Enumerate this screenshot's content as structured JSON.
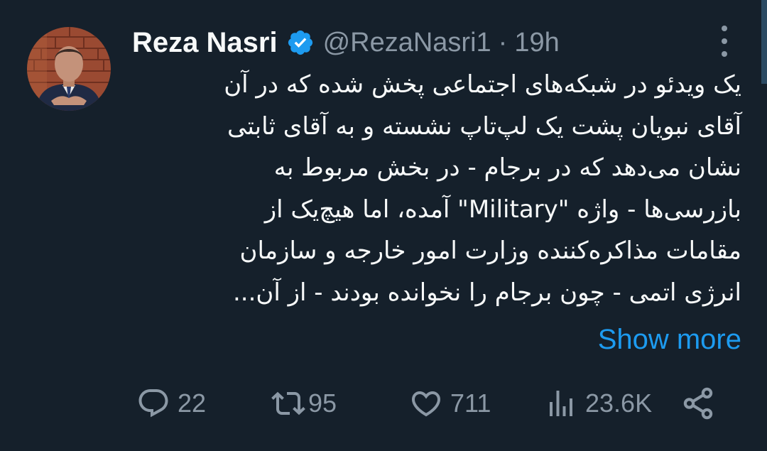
{
  "author": {
    "name": "Reza Nasri",
    "handle": "@RezaNasri1",
    "separator": "·",
    "time": "19h",
    "verified": true
  },
  "tweet": {
    "lines": [
      "یک ویدئو در شبکه‌های اجتماعی پخش شده که در آن",
      "آقای نبویان پشت یک لپ‌تاپ نشسته و به آقای ثابتی",
      "نشان می‌دهد که در برجام - در بخش مربوط به",
      "بازرسی‌ها - واژه \"Military\" آمده، اما هیچ‌یک از",
      "مقامات مذاکره‌کننده وزارت امور خارجه و سازمان",
      "انرژی اتمی - چون برجام را نخوانده بودند - از آن..."
    ],
    "show_more": "Show more"
  },
  "actions": {
    "replies": "22",
    "retweets": "95",
    "likes": "711",
    "views": "23.6K"
  },
  "icons": {
    "verified": "verified-badge-icon",
    "more": "more-options-icon",
    "reply": "reply-icon",
    "retweet": "retweet-icon",
    "like": "heart-icon",
    "views": "views-icon",
    "share": "share-icon"
  },
  "colors": {
    "background": "#15202b",
    "text": "#f7f9f9",
    "muted": "#8b98a5",
    "accent": "#1d9bf0"
  }
}
